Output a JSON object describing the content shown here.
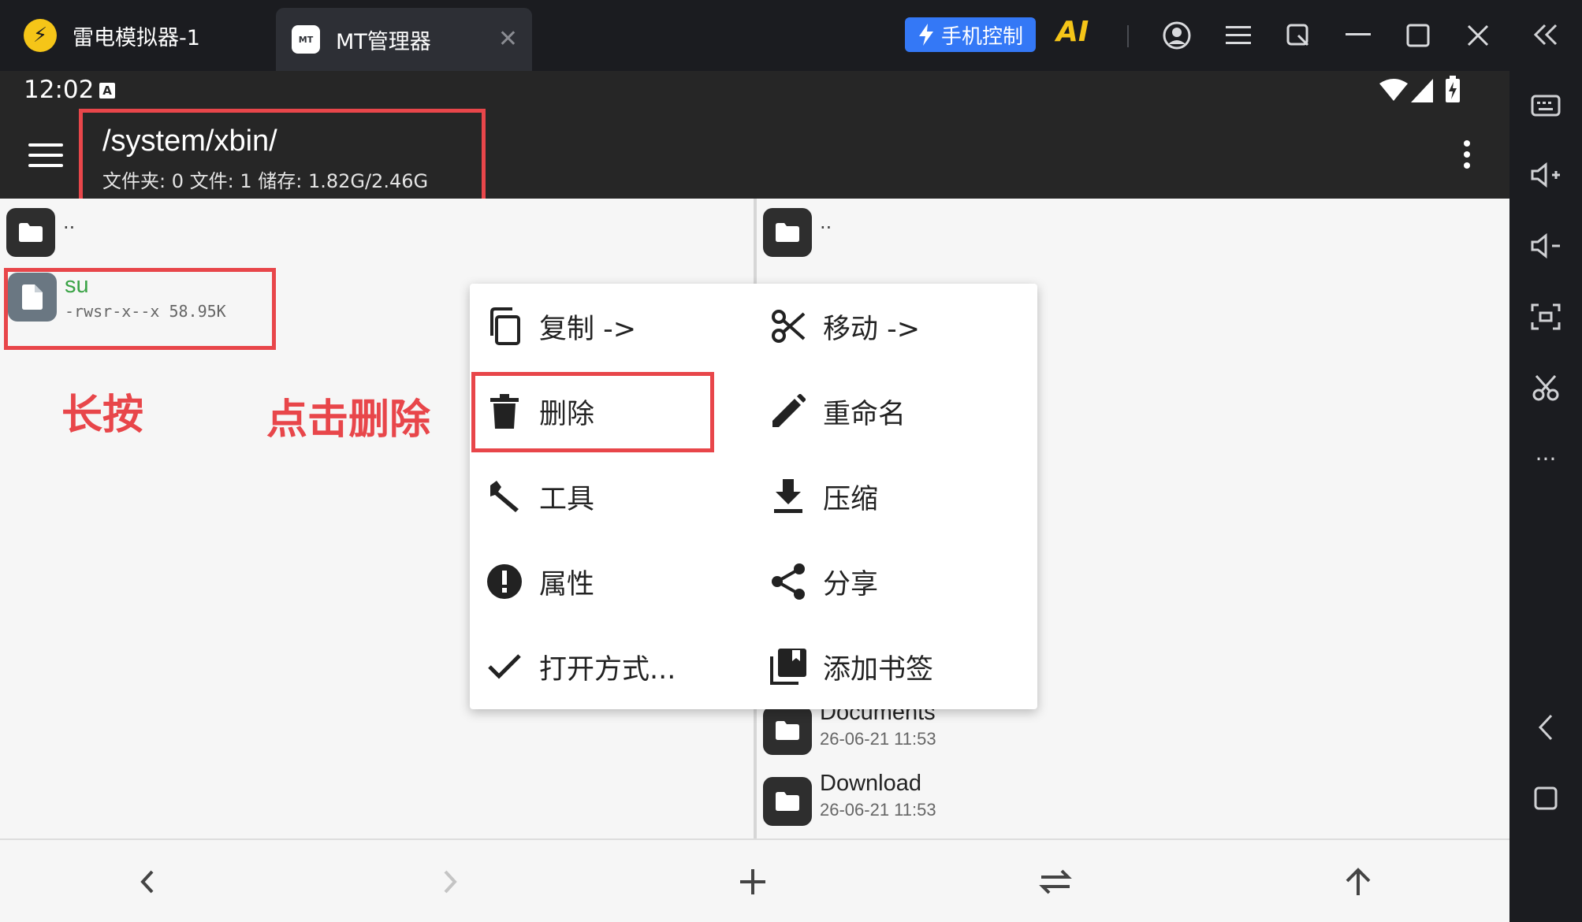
{
  "emulator": {
    "tab1_label": "雷电模拟器-1",
    "tab2_label": "MT管理器",
    "tab2_icon_text": "MT",
    "phone_control_label": "手机控制",
    "ai_label": "AI",
    "accent_color": "#3478f6"
  },
  "statusbar": {
    "time": "12:02",
    "badge": "A"
  },
  "appbar": {
    "path": "/system/xbin/",
    "summary": "文件夹: 0  文件: 1  储存: 1.82G/2.46G"
  },
  "left_pane": {
    "parent_label": "..",
    "file": {
      "name": "su",
      "meta": "-rwsr-x--x  58.95K"
    }
  },
  "right_pane": {
    "parent_label": "..",
    "items": [
      {
        "name": "Documents",
        "date": "26-06-21 11:53"
      },
      {
        "name": "Download",
        "date": "26-06-21 11:53"
      }
    ]
  },
  "annotations": {
    "long_press": "长按",
    "tap_delete": "点击删除",
    "color": "#e8464a"
  },
  "menu": {
    "copy": "复制 ->",
    "move": "移动 ->",
    "delete": "删除",
    "rename": "重命名",
    "tools": "工具",
    "compress": "压缩",
    "properties": "属性",
    "share": "分享",
    "open_with": "打开方式...",
    "bookmark": "添加书签"
  }
}
